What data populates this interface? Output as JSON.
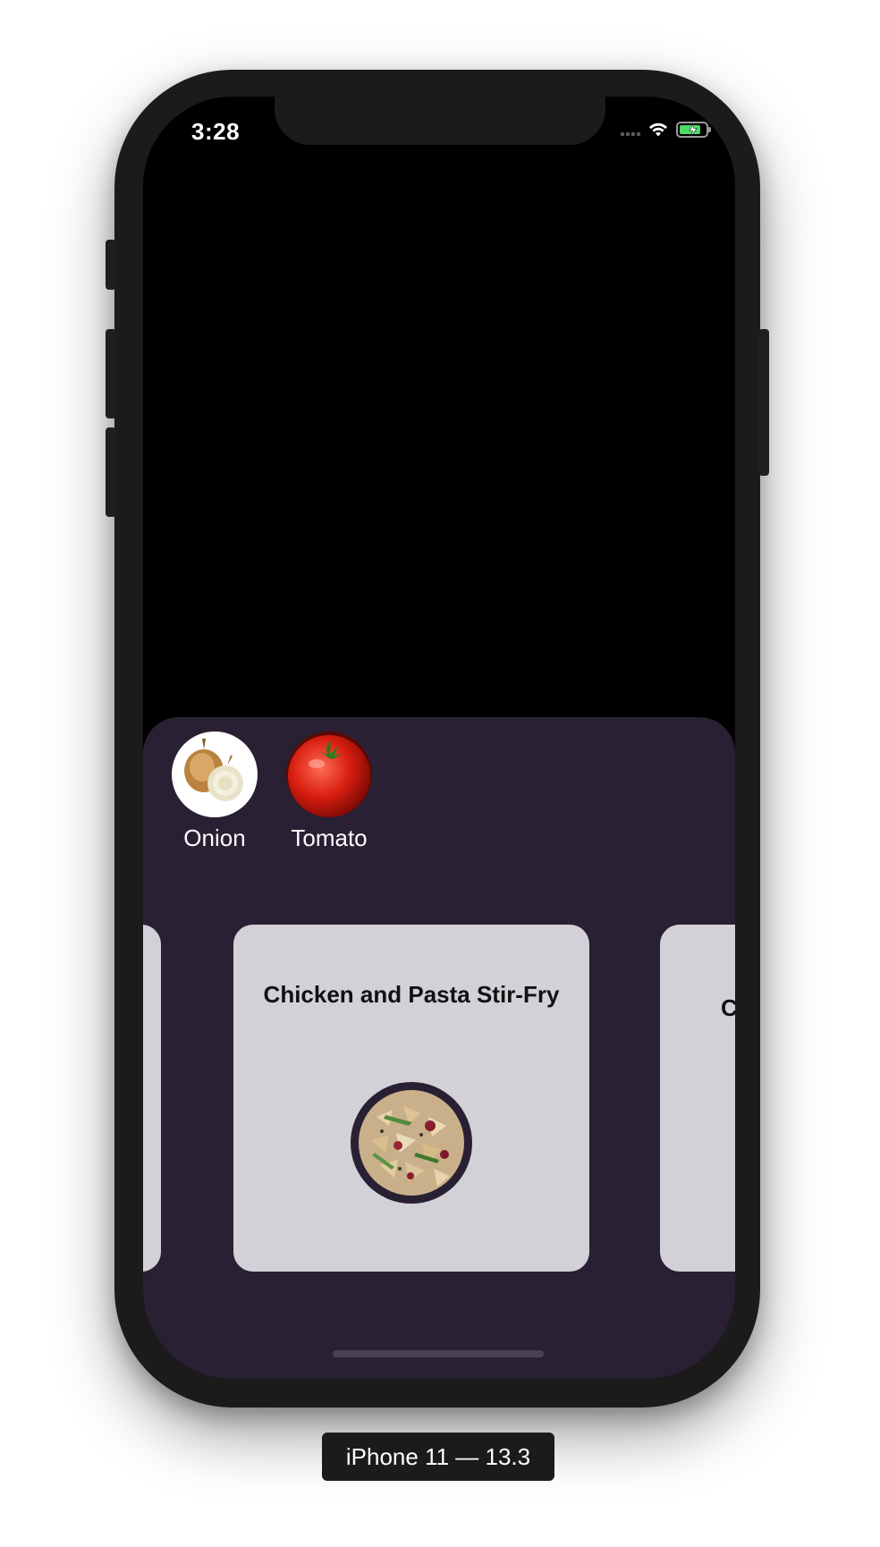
{
  "status_bar": {
    "time": "3:28",
    "battery_color": "#4cd964"
  },
  "ingredients": [
    {
      "label": "Onion",
      "icon": "onion-image"
    },
    {
      "label": "Tomato",
      "icon": "tomato-image"
    }
  ],
  "recipes": {
    "current": {
      "title": "Chicken and Pasta Stir-Fry",
      "image": "pasta-dish-image"
    },
    "next_partial_title": "C"
  },
  "device_label": "iPhone 11 — 13.3",
  "colors": {
    "sheet": "#2a2033",
    "card": "#d3d1d8",
    "screen": "#000000"
  }
}
